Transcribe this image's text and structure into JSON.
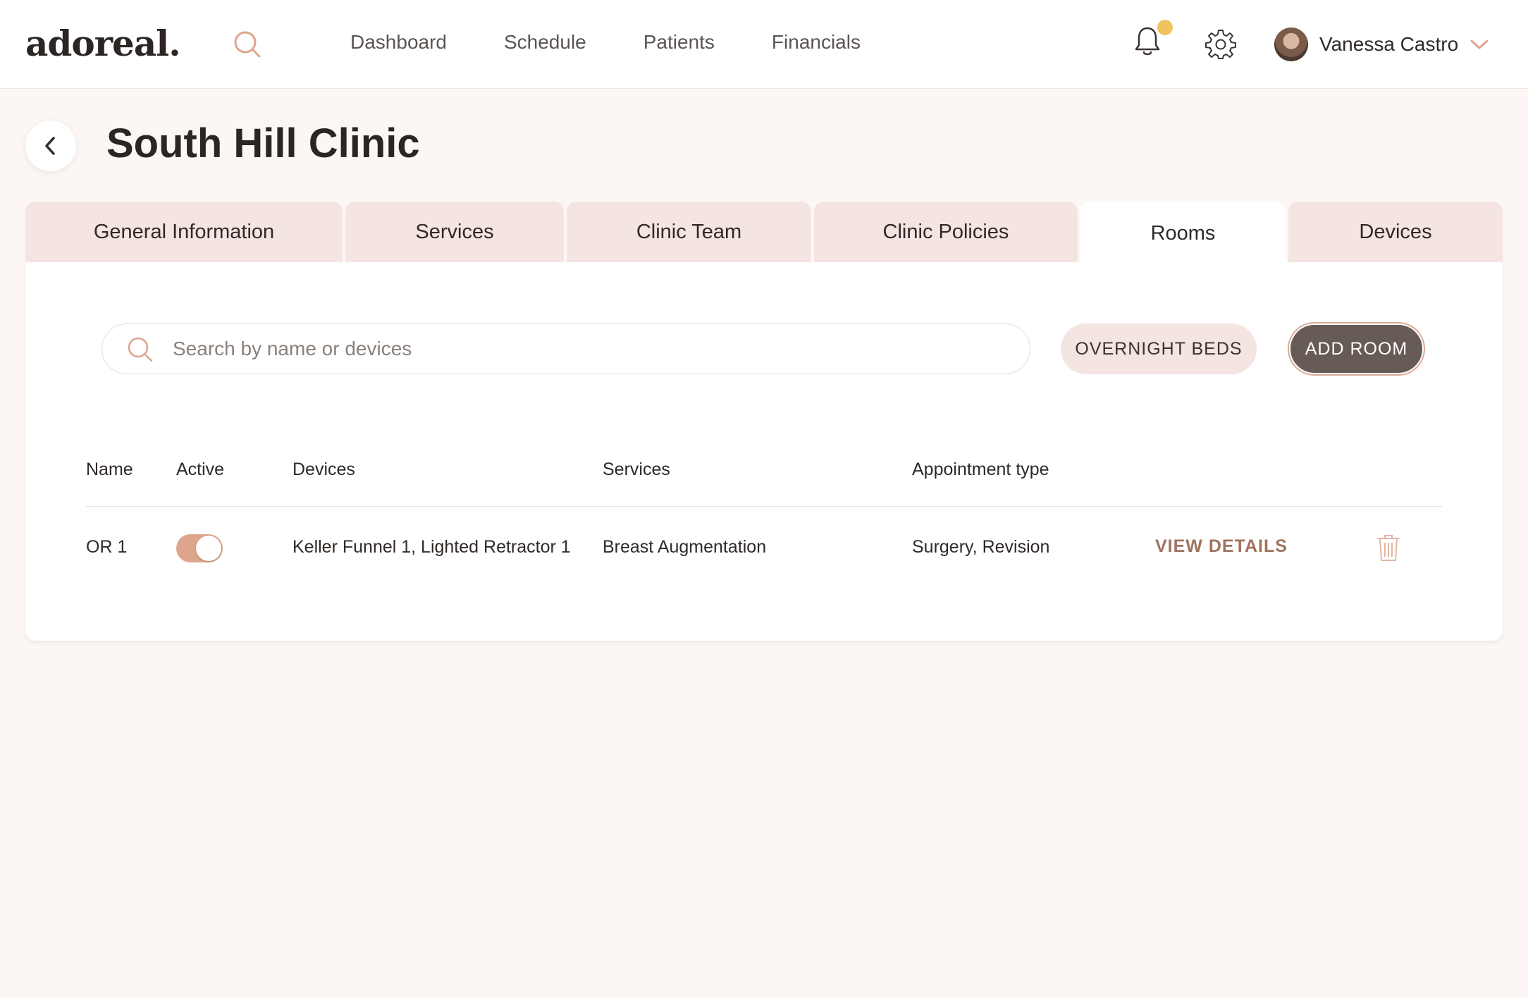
{
  "app": {
    "logo": "adoreal."
  },
  "nav": {
    "links": [
      "Dashboard",
      "Schedule",
      "Patients",
      "Financials"
    ],
    "user_name": "Vanessa Castro"
  },
  "colors": {
    "accent": "#dea58d",
    "tab_bg": "#f4e4e2",
    "primary_button": "#675b56",
    "link": "#a0735e",
    "notification_dot": "#f0c35f",
    "page_bg": "#fcf7f4"
  },
  "icons": {
    "search": "search-icon",
    "bell": "bell-icon",
    "gear": "gear-icon",
    "user_menu": "chevron-down-icon",
    "back": "chevron-left-icon",
    "delete": "trash-icon"
  },
  "page": {
    "title": "South Hill Clinic"
  },
  "tabs": [
    {
      "label": "General Information",
      "active": false
    },
    {
      "label": "Services",
      "active": false
    },
    {
      "label": "Clinic Team",
      "active": false
    },
    {
      "label": "Clinic Policies",
      "active": false
    },
    {
      "label": "Rooms",
      "active": true
    },
    {
      "label": "Devices",
      "active": false
    }
  ],
  "toolbar": {
    "search_placeholder": "Search by name or devices",
    "overnight_beds_label": "OVERNIGHT BEDS",
    "add_room_label": "ADD ROOM"
  },
  "table": {
    "columns": [
      "Name",
      "Active",
      "Devices",
      "Services",
      "Appointment type"
    ],
    "rows": [
      {
        "name": "OR 1",
        "active": true,
        "devices": "Keller Funnel 1, Lighted Retractor 1",
        "services": "Breast Augmentation",
        "appointment_type": "Surgery, Revision",
        "action_label": "VIEW DETAILS"
      }
    ]
  }
}
